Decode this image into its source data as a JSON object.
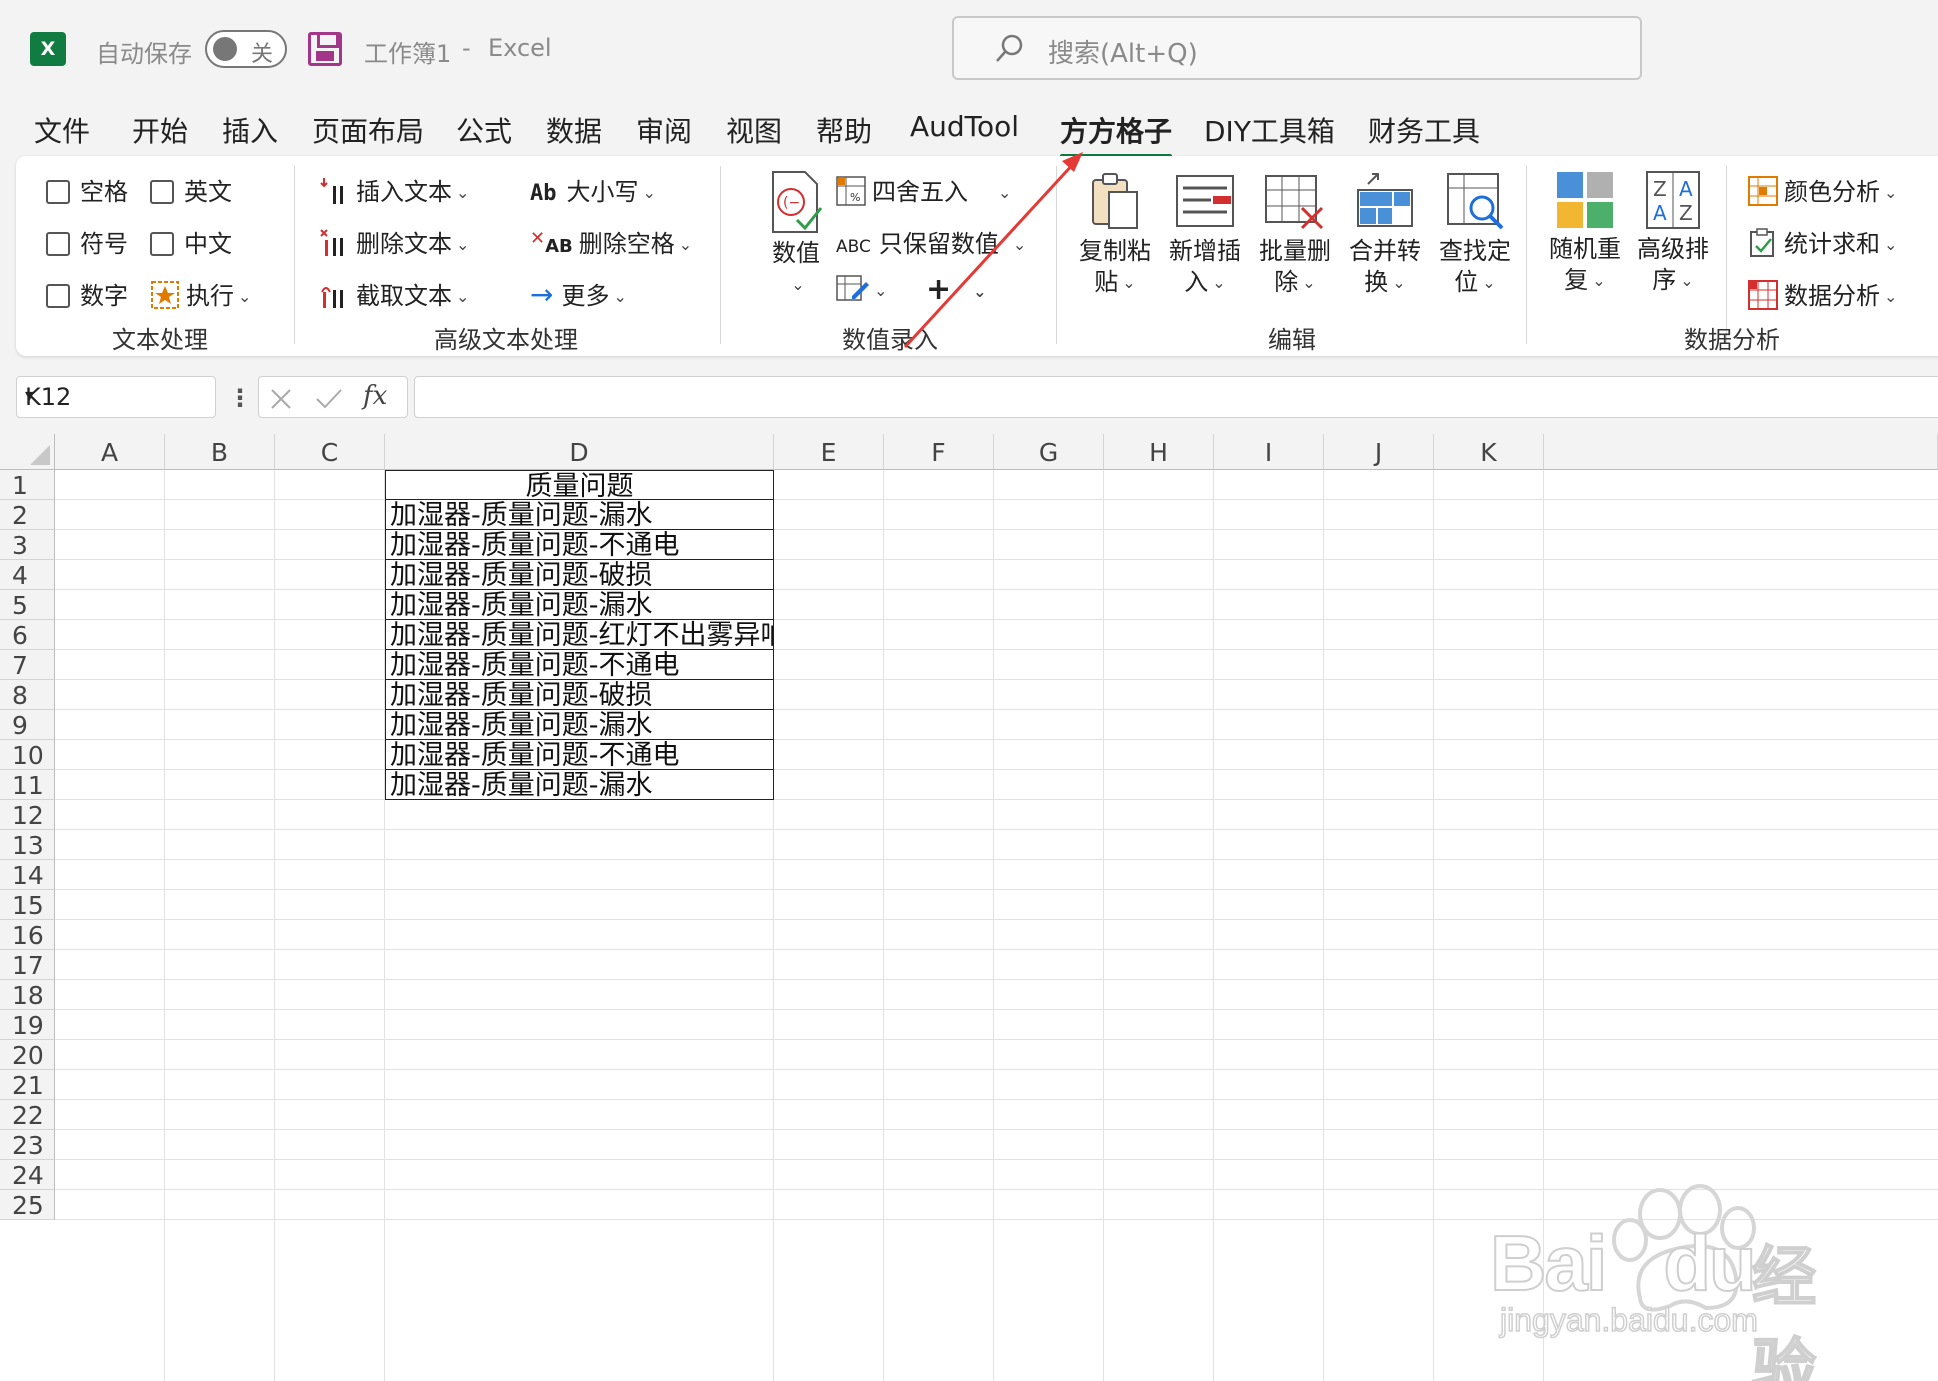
{
  "titlebar": {
    "logo_letter": "X",
    "autosave_label": "自动保存",
    "autosave_state": "关",
    "workbook": "工作簿1",
    "separator": "-",
    "app_name": "Excel",
    "search_placeholder": "搜索(Alt+Q)"
  },
  "menu": {
    "tabs": [
      "文件",
      "开始",
      "插入",
      "页面布局",
      "公式",
      "数据",
      "审阅",
      "视图",
      "帮助",
      "AudTool",
      "方方格子",
      "DIY工具箱",
      "财务工具"
    ],
    "active_tab": "方方格子"
  },
  "ribbon": {
    "text_group": {
      "label": "文本处理",
      "checks": [
        "空格",
        "英文",
        "符号",
        "中文",
        "数字"
      ],
      "execute": "执行"
    },
    "adv_text_group": {
      "label": "高级文本处理",
      "insert_text": "插入文本",
      "delete_text": "删除文本",
      "extract_text": "截取文本",
      "case": "大小写",
      "case_icon_text": "Ab",
      "delete_space": "删除空格",
      "delete_space_icon_text": "AB",
      "more": "更多"
    },
    "value_group": {
      "label": "数值录入",
      "value_btn": "数值",
      "round": "四舍五入",
      "keep_value": "只保留数值",
      "keep_value_icon_text": "ABC"
    },
    "edit_group": {
      "label": "编辑",
      "copy_paste": [
        "复制粘",
        "贴"
      ],
      "insert": [
        "新增插",
        "入"
      ],
      "batch_delete": [
        "批量删",
        "除"
      ],
      "merge": [
        "合并转",
        "换"
      ],
      "find": [
        "查找定",
        "位"
      ]
    },
    "analysis_group": {
      "label": "数据分析",
      "random": [
        "随机重",
        "复"
      ],
      "sort": [
        "高级排",
        "序"
      ],
      "color_analysis": "颜色分析",
      "sum": "统计求和",
      "data_analysis": "数据分析"
    }
  },
  "formula_bar": {
    "name_box": "K12",
    "fx_label": "fx",
    "formula": ""
  },
  "sheet": {
    "columns": [
      "A",
      "B",
      "C",
      "D",
      "E",
      "F",
      "G",
      "H",
      "I",
      "J",
      "K"
    ],
    "rows": [
      "1",
      "2",
      "3",
      "4",
      "5",
      "6",
      "7",
      "8",
      "9",
      "10",
      "11",
      "12",
      "13",
      "14",
      "15",
      "16",
      "17",
      "18",
      "19",
      "20",
      "21",
      "22",
      "23",
      "24",
      "25"
    ],
    "d_column": [
      "质量问题",
      "加湿器-质量问题-漏水",
      "加湿器-质量问题-不通电",
      "加湿器-质量问题-破损",
      "加湿器-质量问题-漏水",
      "加湿器-质量问题-红灯不出雾异响",
      "加湿器-质量问题-不通电",
      "加湿器-质量问题-破损",
      "加湿器-质量问题-漏水",
      "加湿器-质量问题-不通电",
      "加湿器-质量问题-漏水"
    ]
  },
  "watermark": {
    "brand": "Bai",
    "brand2": "du",
    "cn": "经验",
    "url": "jingyan.baidu.com"
  },
  "colors": {
    "excel_green": "#107c41",
    "arrow_red": "#e53935",
    "save_purple": "#a4368a"
  }
}
